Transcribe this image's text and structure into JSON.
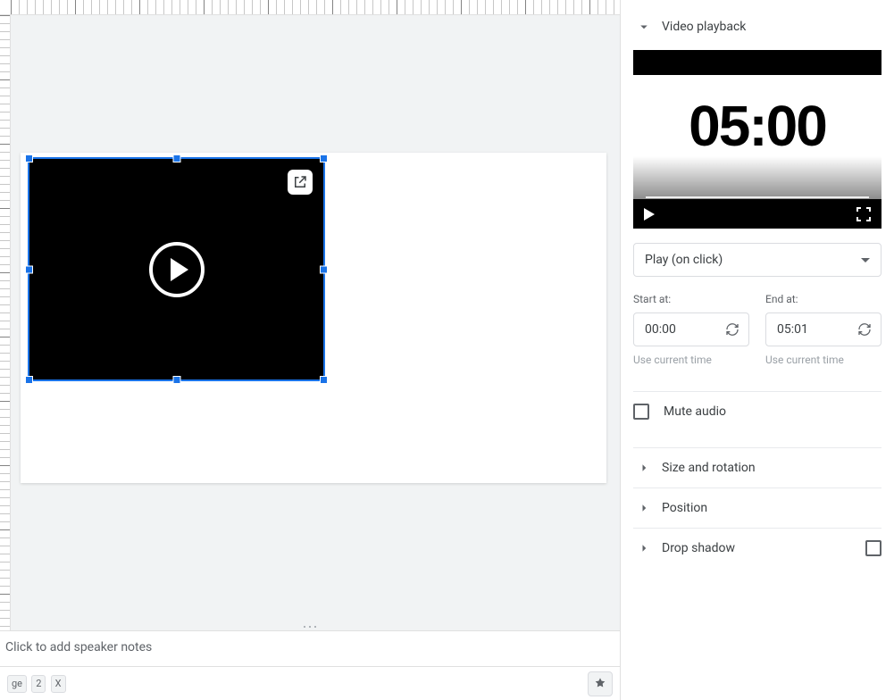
{
  "canvas": {
    "preview_time_big": "05:00"
  },
  "notes": {
    "placeholder": "Click to add speaker notes"
  },
  "bottombar": {
    "chip1": "ge",
    "chip2": "2",
    "chip3": "X"
  },
  "sidebar": {
    "video_playback": {
      "title": "Video playback",
      "play_mode": "Play (on click)",
      "start_label": "Start at:",
      "start_value": "00:00",
      "end_label": "End at:",
      "end_value": "05:01",
      "use_current_time": "Use current time",
      "mute_label": "Mute audio"
    },
    "size_rotation": {
      "title": "Size and rotation"
    },
    "position": {
      "title": "Position"
    },
    "drop_shadow": {
      "title": "Drop shadow"
    }
  }
}
